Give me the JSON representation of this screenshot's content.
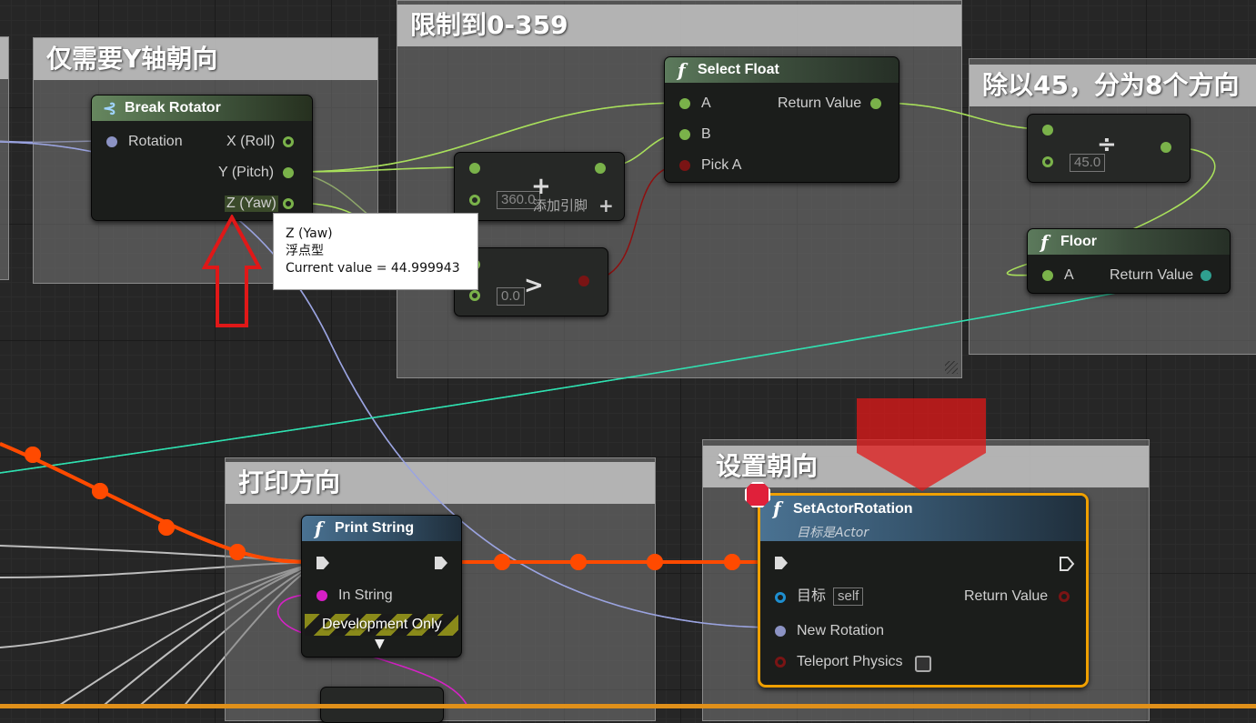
{
  "comments": {
    "yaw_only": "仅需要Y轴朝向",
    "clamp": "限制到0-359",
    "divide": "除以45，分为8个方向",
    "print": "打印方向",
    "set_rotation": "设置朝向"
  },
  "break_rotator": {
    "title": "Break Rotator",
    "input_rotation": "Rotation",
    "out_roll": "X (Roll)",
    "out_pitch": "Y (Pitch)",
    "out_yaw": "Z (Yaw)"
  },
  "add_node": {
    "symbol": "+",
    "default_value": "360.0",
    "add_pin_label": "添加引脚"
  },
  "greater_node": {
    "symbol": ">",
    "default_value": "0.0"
  },
  "select_float": {
    "title": "Select Float",
    "pin_a": "A",
    "pin_b": "B",
    "pin_pick_a": "Pick A",
    "return_value": "Return Value"
  },
  "divide_node": {
    "symbol": "÷",
    "default_value": "45.0"
  },
  "floor_node": {
    "title": "Floor",
    "pin_a": "A",
    "return_value": "Return Value"
  },
  "print_string": {
    "title": "Print String",
    "in_string": "In String",
    "dev_only": "Development Only"
  },
  "set_actor_rotation": {
    "title": "SetActorRotation",
    "subtitle": "目标是Actor",
    "target_label": "目标",
    "target_value": "self",
    "new_rotation": "New Rotation",
    "teleport": "Teleport Physics",
    "return_value": "Return Value",
    "teleport_checked": false
  },
  "tooltip": {
    "line1": "Z (Yaw)",
    "line2": "浮点型",
    "line3": "Current value = 44.999943"
  },
  "colors": {
    "exec_active": "#ff4a00",
    "float_wire": "#a8e05a",
    "rotator_wire": "#9aa3e0",
    "bool_wire": "#8b1010",
    "int_wire": "#2fe0b0",
    "string_wire": "#d61fc6",
    "annotation_arrow": "#e01818",
    "breakpoint": "#e0203a",
    "selection_outline": "#f0a000"
  }
}
